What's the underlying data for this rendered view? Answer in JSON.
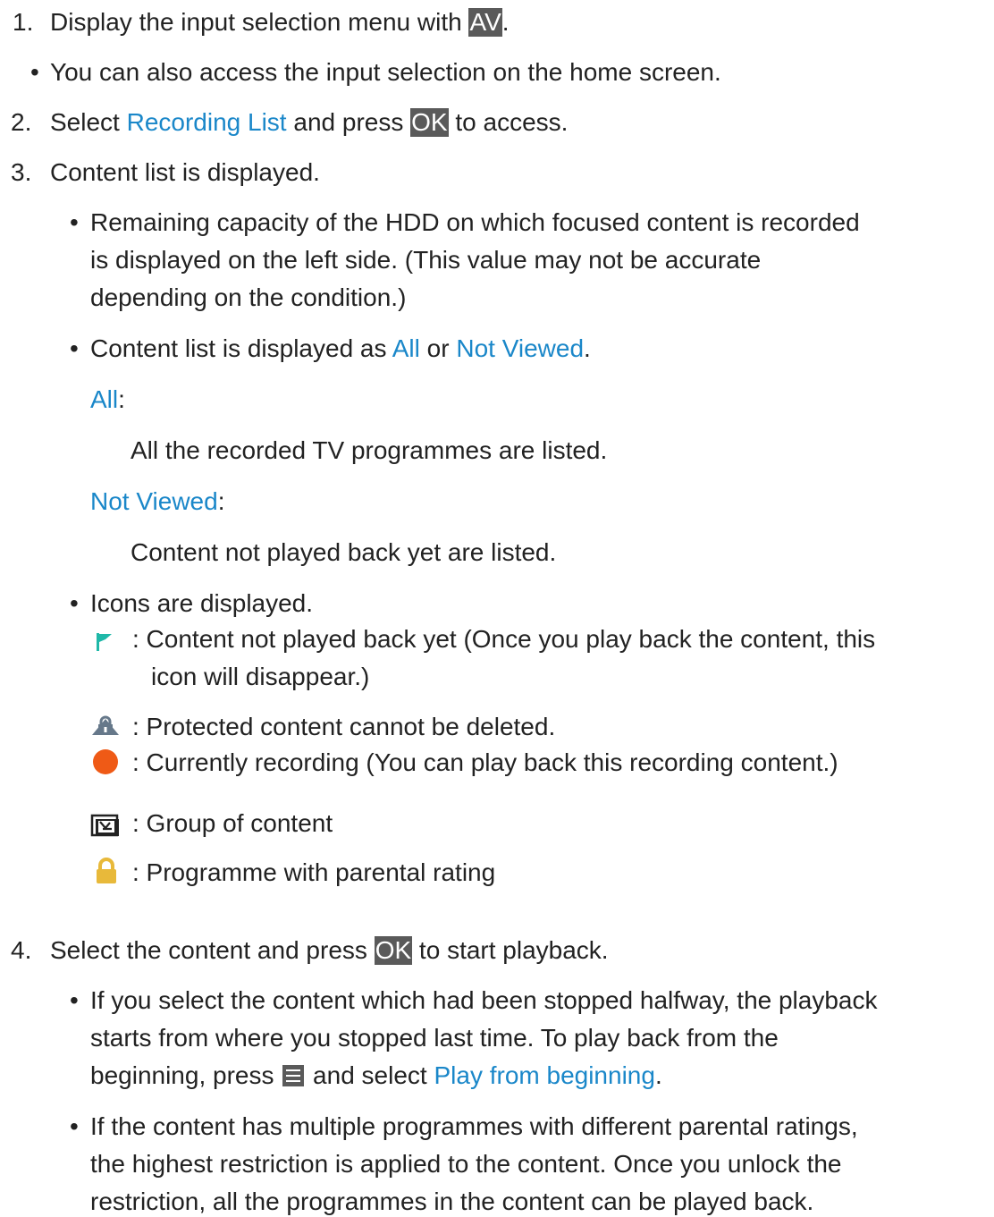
{
  "step1": {
    "num": "1.",
    "text": "Display the input selection menu with ",
    "key": "AV",
    "end": "."
  },
  "bullet_home": "You can also access the input selection on the home screen.",
  "step2": {
    "num": "2.",
    "pre": "Select ",
    "link": "Recording List",
    "mid": " and press ",
    "key": "OK",
    "post": " to access."
  },
  "step3": {
    "num": "3.",
    "text": "Content list is displayed."
  },
  "remaining": {
    "line1": "Remaining capacity of the HDD on which focused content is recorded",
    "line2": "is displayed on the left side. (This value may not be accurate",
    "line3": "depending on the condition.)"
  },
  "content_list": {
    "pre": "Content list is displayed as ",
    "link1": "All",
    "mid": " or ",
    "link2": "Not Viewed",
    "post": "."
  },
  "all_term": {
    "label": "All",
    "colon": ":",
    "desc": "All the recorded TV programmes are listed."
  },
  "notviewed_term": {
    "label": "Not Viewed",
    "colon": ":",
    "desc": "Content not played back yet are listed."
  },
  "icons_intro": "Icons are displayed.",
  "icon_list": [
    {
      "icon": "green-flag-icon",
      "line1": ": Content not played back yet (Once you play back the content, this",
      "line2": "icon will disappear.)"
    },
    {
      "icon": "protect-lock-icon",
      "line1": ": Protected content cannot be deleted."
    },
    {
      "icon": "recording-dot-icon",
      "line1": ": Currently recording (You can play back this recording content.)"
    },
    {
      "icon": "group-icon",
      "line1": ": Group of content"
    },
    {
      "icon": "parental-lock-icon",
      "line1": ": Programme with parental rating"
    }
  ],
  "step4": {
    "num": "4.",
    "pre": "Select the content and press ",
    "key": "OK",
    "post": " to start playback."
  },
  "halfway": {
    "line1": "If you select the content which had been stopped halfway, the playback",
    "line2": "starts from where you stopped last time. To play back from the",
    "line3_pre": "beginning, press ",
    "line3_mid": " and select ",
    "line3_link": "Play from beginning",
    "line3_post": "."
  },
  "parental": {
    "line1": "If the content has multiple programmes with different parental ratings,",
    "line2": "the highest restriction is applied to the content. Once you unlock the",
    "line3": "restriction, all the programmes in the content can be played back."
  },
  "bullet_char": "•",
  "colors": {
    "link": "#1a87c9",
    "key_bg": "#5a5a5a",
    "flag": "#1fb8a8",
    "record": "#ef5a16",
    "lock": "#e8b93a"
  }
}
